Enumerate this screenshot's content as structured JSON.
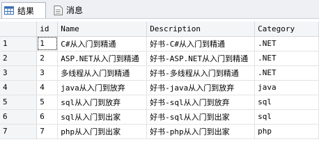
{
  "tabs": [
    {
      "label": "结果",
      "icon": "grid-icon",
      "active": true
    },
    {
      "label": "消息",
      "icon": "message-icon",
      "active": false
    }
  ],
  "grid": {
    "columns": [
      "id",
      "Name",
      "Description",
      "Category"
    ],
    "rows": [
      {
        "num": "1",
        "id": "1",
        "name": "C#从入门到精通",
        "description": "好书-C#从入门到精通",
        "category": ".NET"
      },
      {
        "num": "2",
        "id": "2",
        "name": "ASP.NET从入门到精通",
        "description": "好书-ASP.NET从入门到精通",
        "category": ".NET"
      },
      {
        "num": "3",
        "id": "3",
        "name": "多线程从入门到精通",
        "description": "好书-多线程从入门到精通",
        "category": ".NET"
      },
      {
        "num": "4",
        "id": "4",
        "name": "java从入门到放弃",
        "description": "好书-java从入门到放弃",
        "category": "java"
      },
      {
        "num": "5",
        "id": "5",
        "name": "sql从入门到放弃",
        "description": "好书-sql从入门到放弃",
        "category": "sql"
      },
      {
        "num": "6",
        "id": "6",
        "name": "sql从入门到出家",
        "description": "好书-sql从入门到出家",
        "category": "sql"
      },
      {
        "num": "7",
        "id": "7",
        "name": "php从入门到出家",
        "description": "好书-php从入门到出家",
        "category": "php"
      }
    ]
  }
}
